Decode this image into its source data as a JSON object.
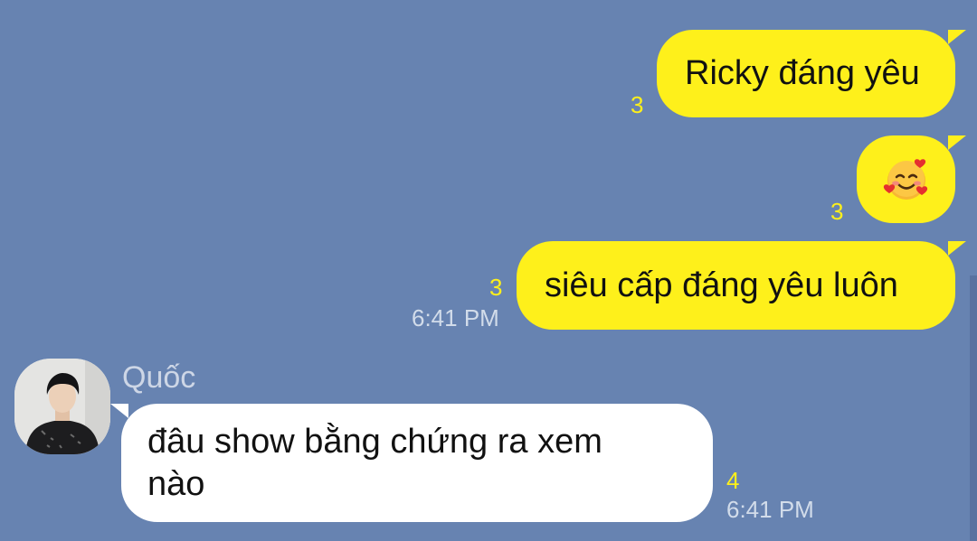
{
  "messages": {
    "m1": {
      "text": "Ricky đáng yêu",
      "read_count": "3"
    },
    "m2": {
      "emoji": "🥰",
      "icon": "smiling-face-with-hearts-icon",
      "read_count": "3"
    },
    "m3": {
      "text": "siêu cấp đáng yêu luôn",
      "read_count": "3",
      "time": "6:41 PM"
    },
    "m4": {
      "sender": "Quốc",
      "line1": "đâu show bằng chứng ra xem",
      "line2": "nào",
      "read_count": "4",
      "time": "6:41 PM"
    }
  },
  "colors": {
    "background": "#6783b1",
    "my_bubble": "#fef01b",
    "their_bubble": "#ffffff",
    "read_count": "#fef01b"
  }
}
